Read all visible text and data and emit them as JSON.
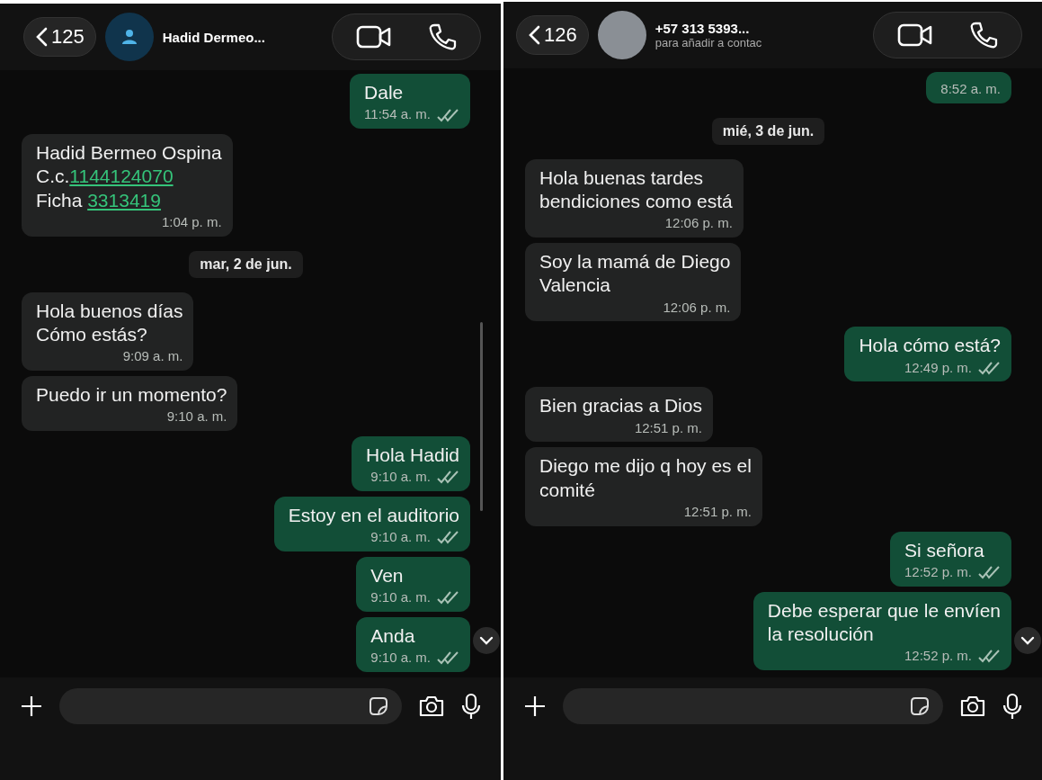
{
  "panels": [
    {
      "header": {
        "back_count": "125",
        "photo": false,
        "name": "Hadid Dermeo..."
      },
      "messages": [
        {
          "kind": "outgoing",
          "text": "Dale",
          "time": "11:54 a. m.",
          "ticks": true
        },
        {
          "kind": "incoming",
          "lines": [
            [
              {
                "text": "Hadid Bermeo Ospina",
                "link": false
              }
            ],
            [
              {
                "text": "C.c.",
                "link": false
              },
              {
                "text": "1144124070",
                "link": true
              }
            ],
            [
              {
                "text": "Ficha ",
                "link": false
              },
              {
                "text": "3313419",
                "link": true
              }
            ]
          ],
          "time": "1:04 p. m."
        },
        {
          "kind": "date",
          "text": "mar, 2 de jun."
        },
        {
          "kind": "incoming",
          "text": "Hola buenos días\nCómo estás?",
          "time": "9:09 a. m."
        },
        {
          "kind": "incoming",
          "text": "Puedo ir un momento?",
          "time": "9:10 a. m."
        },
        {
          "kind": "outgoing",
          "text": "Hola Hadid",
          "time": "9:10 a. m.",
          "ticks": true
        },
        {
          "kind": "outgoing",
          "text": "Estoy en el auditorio",
          "time": "9:10 a. m.",
          "ticks": true
        },
        {
          "kind": "outgoing",
          "text": "Ven",
          "time": "9:10 a. m.",
          "ticks": true
        },
        {
          "kind": "outgoing",
          "text": "Anda",
          "time": "9:10 a. m.",
          "ticks": true
        }
      ],
      "scrollbar": true
    },
    {
      "header": {
        "back_count": "126",
        "photo": true,
        "name": "+57 313 5393...",
        "subtitle": "para añadir a contac"
      },
      "messages": [
        {
          "kind": "outgoing",
          "time": "8:52 a. m.",
          "ticks": false
        },
        {
          "kind": "date",
          "text": "mié, 3 de jun."
        },
        {
          "kind": "incoming",
          "text": "Hola buenas tardes\nbendiciones como está",
          "time": "12:06 p. m."
        },
        {
          "kind": "incoming",
          "text": "Soy la mamá de Diego\nValencia",
          "time": "12:06 p. m."
        },
        {
          "kind": "outgoing",
          "text": "Hola cómo está?",
          "time": "12:49 p. m.",
          "ticks": true
        },
        {
          "kind": "incoming",
          "text": "Bien gracias a Dios",
          "time": "12:51 p. m."
        },
        {
          "kind": "incoming",
          "text": "Diego me dijo q hoy es el\ncomité",
          "time": "12:51 p. m."
        },
        {
          "kind": "outgoing",
          "text": "Si señora",
          "time": "12:52 p. m.",
          "ticks": true
        },
        {
          "kind": "outgoing",
          "text": "Debe esperar que le envíen\nla resolución",
          "time": "12:52 p. m.",
          "ticks": true
        }
      ],
      "scrollbar": false
    }
  ]
}
